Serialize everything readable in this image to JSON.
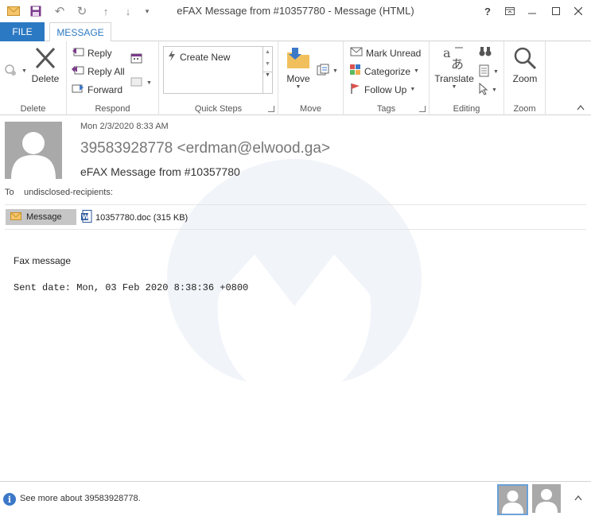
{
  "window": {
    "title": "eFAX Message from  #10357780 - Message (HTML)",
    "help": "?"
  },
  "tabs": {
    "file": "FILE",
    "message": "MESSAGE"
  },
  "ribbon": {
    "delete": {
      "label": "Delete",
      "group": "Delete"
    },
    "respond": {
      "reply": "Reply",
      "reply_all": "Reply All",
      "forward": "Forward",
      "group": "Respond"
    },
    "quick_steps": {
      "create_new": "Create New",
      "group": "Quick Steps"
    },
    "move": {
      "label": "Move",
      "group": "Move"
    },
    "tags": {
      "mark_unread": "Mark Unread",
      "categorize": "Categorize",
      "follow_up": "Follow Up",
      "group": "Tags"
    },
    "editing": {
      "translate": "Translate",
      "group": "Editing"
    },
    "zoom": {
      "label": "Zoom",
      "group": "Zoom"
    }
  },
  "message": {
    "date": "Mon 2/3/2020 8:33 AM",
    "sender": "39583928778 <erdman@elwood.ga>",
    "subject": "eFAX Message from  #10357780",
    "to_label": "To",
    "to_value": "undisclosed-recipients:",
    "attachment_tab": "Message",
    "attachment_file": "10357780.doc (315 KB)",
    "body_line1": "Fax message",
    "body_line2": "Sent date: Mon, 03 Feb 2020 8:38:36 +0800"
  },
  "people_pane": {
    "see_more": "See more about 39583928778."
  },
  "colors": {
    "accent": "#2b79c2",
    "avatar_bg": "#a9a9a9",
    "watermark": "#f1f4f9"
  }
}
